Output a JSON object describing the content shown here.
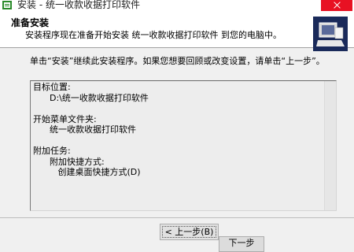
{
  "window": {
    "title": "安装 - 统一收款收据打印软件"
  },
  "header": {
    "title": "准备安装",
    "subtitle": "安装程序现在准备开始安装 统一收款收据打印软件 到您的电脑中。"
  },
  "instruction": "单击“安装”继续此安装程序。如果您想要回顾或改变设置，请单击“上一步”。",
  "summary": {
    "text": "目标位置:\n      D:\\统一收款收据打印软件\n\n开始菜单文件夹:\n      统一收款收据打印软件\n\n附加任务:\n      附加快捷方式:\n         创建桌面快捷方式(D)"
  },
  "buttons": {
    "back": "< 上一步(B)",
    "next": "下一步"
  },
  "colors": {
    "close_button": "#e81123",
    "dialog_bg": "#f0f0f0"
  }
}
